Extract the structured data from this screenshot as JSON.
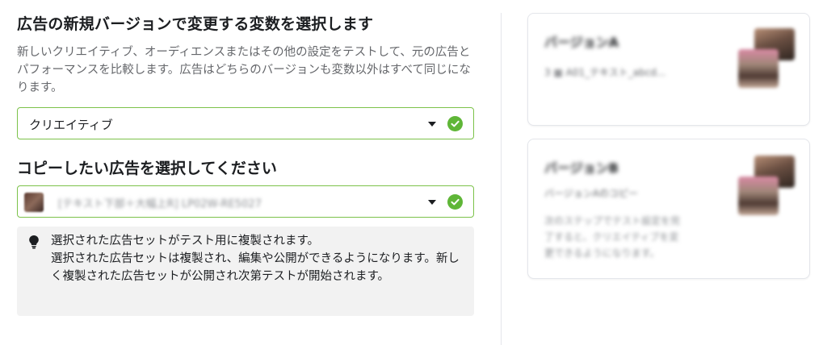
{
  "heading": "広告の新規バージョンで変更する変数を選択します",
  "description": "新しいクリエイティブ、オーディエンスまたはその他の設定をテストして、元の広告とパフォーマンスを比較します。広告はどちらのバージョンも変数以外はすべて同じになります。",
  "variable_select": {
    "value": "クリエイティブ"
  },
  "copy_heading": "コピーしたい広告を選択してください",
  "ad_select": {
    "value": "[テキスト下部＋大幅上R] LP02W-RE5027"
  },
  "info": {
    "line1": "選択された広告セットがテスト用に複製されます。",
    "line2": "選択された広告セットは複製され、編集や公開ができるようになります。新しく複製された広告セットが公開され次第テストが開始されます。"
  },
  "preview": {
    "card_a": {
      "title": "バージョンA",
      "sub": "3 ▦ A01_テキスト_abcd..."
    },
    "card_b": {
      "title": "バージョンB",
      "sub": "バージョンAのコピー",
      "lines": [
        "次のステップでテスト設定を完",
        "了すると、クリエイティブを変",
        "更できるようになります。"
      ]
    }
  },
  "colors": {
    "accent_green": "#5fb637",
    "border_green": "#7cc24a",
    "info_bg": "#f2f2f2"
  }
}
